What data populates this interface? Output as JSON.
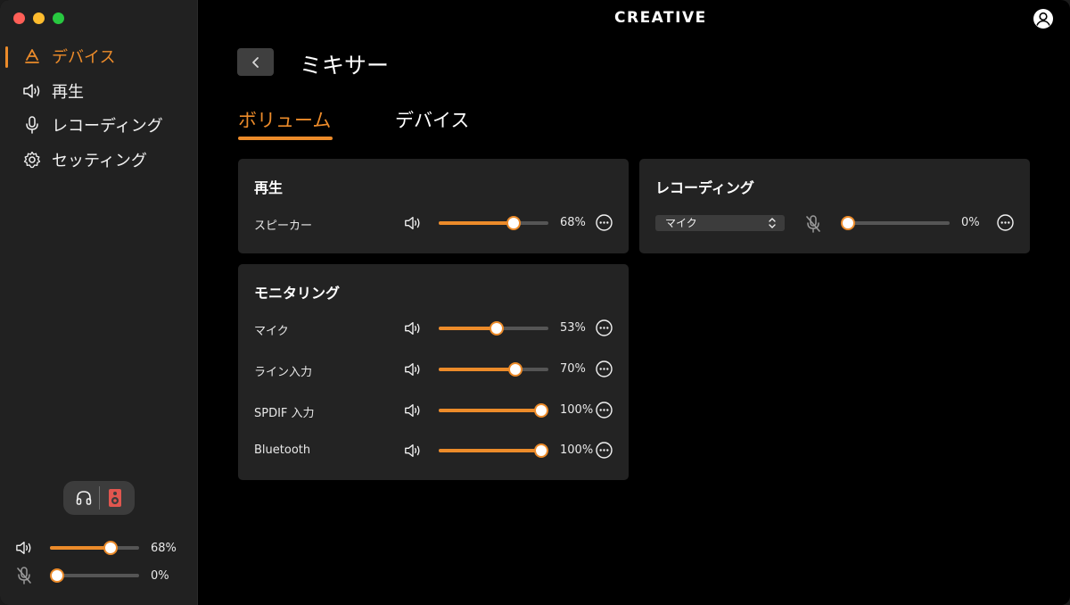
{
  "sidebar": {
    "items": [
      {
        "label": "デバイス",
        "icon": "device-icon",
        "active": true
      },
      {
        "label": "再生",
        "icon": "speaker-icon",
        "active": false
      },
      {
        "label": "レコーディング",
        "icon": "microphone-icon",
        "active": false
      },
      {
        "label": "セッティング",
        "icon": "gear-icon",
        "active": false
      }
    ],
    "output_toggle": {
      "left_icon": "headphones-icon",
      "right_icon": "speaker-box-icon"
    },
    "playback_volume": {
      "percent_label": "68%",
      "value": 0.68
    },
    "recording_volume": {
      "percent_label": "0%",
      "value": 0.0
    }
  },
  "header": {
    "brand": "CREATIVE",
    "title": "ミキサー"
  },
  "tabs": [
    {
      "label": "ボリューム",
      "active": true
    },
    {
      "label": "デバイス",
      "active": false
    }
  ],
  "panels": {
    "playback": {
      "title": "再生",
      "rows": [
        {
          "label": "スピーカー",
          "percent_label": "68%",
          "value": 0.68
        }
      ]
    },
    "recording": {
      "title": "レコーディング",
      "select_value": "マイク",
      "percent_label": "0%",
      "value": 0.0
    },
    "monitoring": {
      "title": "モニタリング",
      "rows": [
        {
          "label": "マイク",
          "percent_label": "53%",
          "value": 0.53
        },
        {
          "label": "ライン入力",
          "percent_label": "70%",
          "value": 0.7
        },
        {
          "label": "SPDIF 入力",
          "percent_label": "100%",
          "value": 1.0
        },
        {
          "label": "Bluetooth",
          "percent_label": "100%",
          "value": 1.0
        }
      ]
    }
  },
  "colors": {
    "accent": "#ec8b2a",
    "panel": "#232323",
    "sidebar": "#212121",
    "background": "#000000"
  }
}
